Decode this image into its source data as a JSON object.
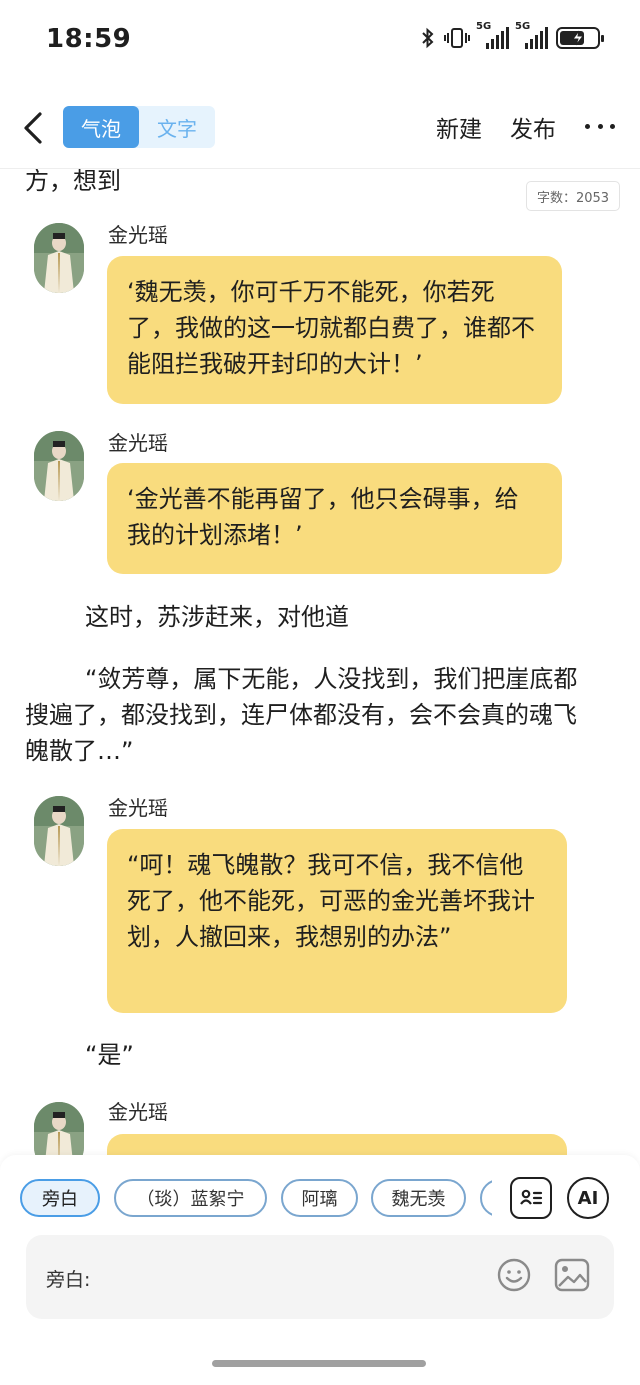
{
  "status": {
    "time": "18:59",
    "signal1_label": "5G",
    "signal2_label": "5G"
  },
  "nav": {
    "tab_bubble": "气泡",
    "tab_text": "文字",
    "new_label": "新建",
    "publish_label": "发布"
  },
  "content": {
    "partial_line": "方，想到",
    "word_count": "字数：2053",
    "messages": [
      {
        "speaker": "金光瑶",
        "text": "‘魏无羡，你可千万不能死，你若死了，我做的这一切就都白费了，谁都不能阻拦我破开封印的大计！’"
      },
      {
        "speaker": "金光瑶",
        "text": "‘金光善不能再留了，他只会碍事，给我的计划添堵！’"
      },
      {
        "speaker": "金光瑶",
        "text": "“呵！魂飞魄散？我可不信，我不信他死了，他不能死，可恶的金光善坏我计划，人撤回来，我想别的办法”"
      },
      {
        "speaker": "金光瑶",
        "text": ""
      }
    ],
    "narration": [
      "这时，苏涉赶来，对他道",
      "“敛芳尊，属下无能，人没找到，我们把崖底都搜遍了，都没找到，连尸体都没有，会不会真的魂飞魄散了…”",
      "“是”"
    ]
  },
  "bottom": {
    "chips": [
      "旁白",
      "（琰）蓝絮宁",
      "阿璃",
      "魏无羡"
    ],
    "ai_label": "AI",
    "input_prefix": "旁白:",
    "input_value": ""
  },
  "colors": {
    "accent": "#4a9de6",
    "bubble": "#f9dc7e",
    "segment_bg": "#e6f3fd"
  }
}
